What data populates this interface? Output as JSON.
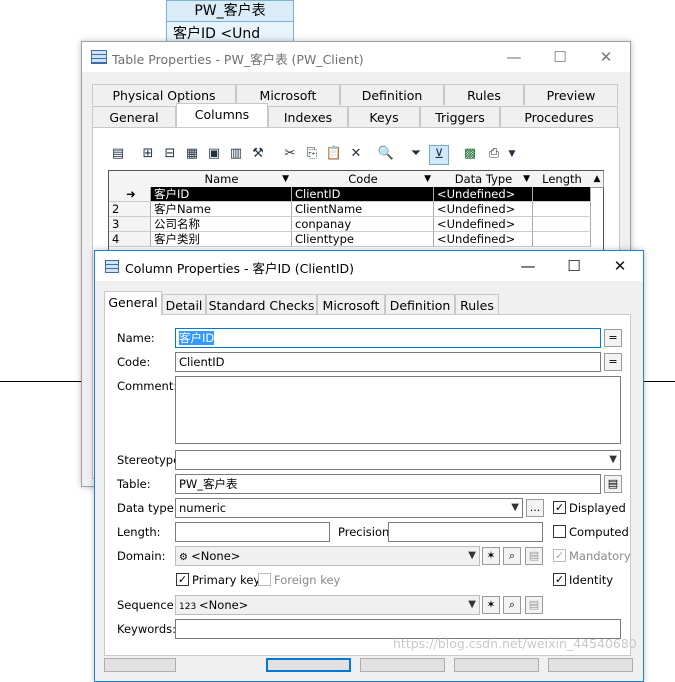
{
  "background": {
    "entity_name": "PW_客户表",
    "entity_row": "客户ID  <Und"
  },
  "table_window": {
    "title": "Table Properties - PW_客户表 (PW_Client)",
    "tabs_row1": [
      "Physical Options",
      "Microsoft",
      "Definition",
      "Rules",
      "Preview"
    ],
    "tabs_row2": [
      "General",
      "Columns",
      "Indexes",
      "Keys",
      "Triggers",
      "Procedures"
    ],
    "selected_tab": "Columns",
    "grid_headers": [
      "Name",
      "Code",
      "Data Type",
      "Length"
    ],
    "rows": [
      {
        "num": "➜",
        "name": "客户ID",
        "code": "ClientID",
        "type": "<Undefined>",
        "selected": true
      },
      {
        "num": "2",
        "name": "客户Name",
        "code": "ClientName",
        "type": "<Undefined>"
      },
      {
        "num": "3",
        "name": "公司名称",
        "code": "conpanay",
        "type": "<Undefined>"
      },
      {
        "num": "4",
        "name": "客户类别",
        "code": "Clienttype",
        "type": "<Undefined>"
      }
    ]
  },
  "column_window": {
    "title": "Column Properties - 客户ID (ClientID)",
    "tabs": [
      "General",
      "Detail",
      "Standard Checks",
      "Microsoft",
      "Definition",
      "Rules"
    ],
    "selected_tab": "General",
    "labels": {
      "name": "Name:",
      "code": "Code:",
      "comment": "Comment:",
      "stereotype": "Stereotype:",
      "table": "Table:",
      "data_type": "Data type:",
      "length": "Length:",
      "precision": "Precision:",
      "domain": "Domain:",
      "sequence": "Sequence:",
      "keywords": "Keywords:"
    },
    "values": {
      "name": "客户ID",
      "code": "ClientID",
      "comment": "",
      "stereotype": "",
      "table": "PW_客户表",
      "data_type": "numeric",
      "length": "",
      "precision": "",
      "domain": "<None>",
      "sequence": "<None>",
      "keywords": ""
    },
    "equals_button": "=",
    "ellipsis_button": "...",
    "checkboxes": {
      "displayed": {
        "label": "Displayed",
        "checked": true
      },
      "computed": {
        "label": "Computed",
        "checked": false
      },
      "mandatory": {
        "label": "Mandatory",
        "checked": true,
        "disabled": true
      },
      "primary_key": {
        "label": "Primary key",
        "checked": true
      },
      "foreign_key": {
        "label": "Foreign key",
        "checked": false,
        "disabled": true
      },
      "identity": {
        "label": "Identity",
        "checked": true
      }
    }
  },
  "watermark": "https://blog.csdn.net/weixin_44540680"
}
